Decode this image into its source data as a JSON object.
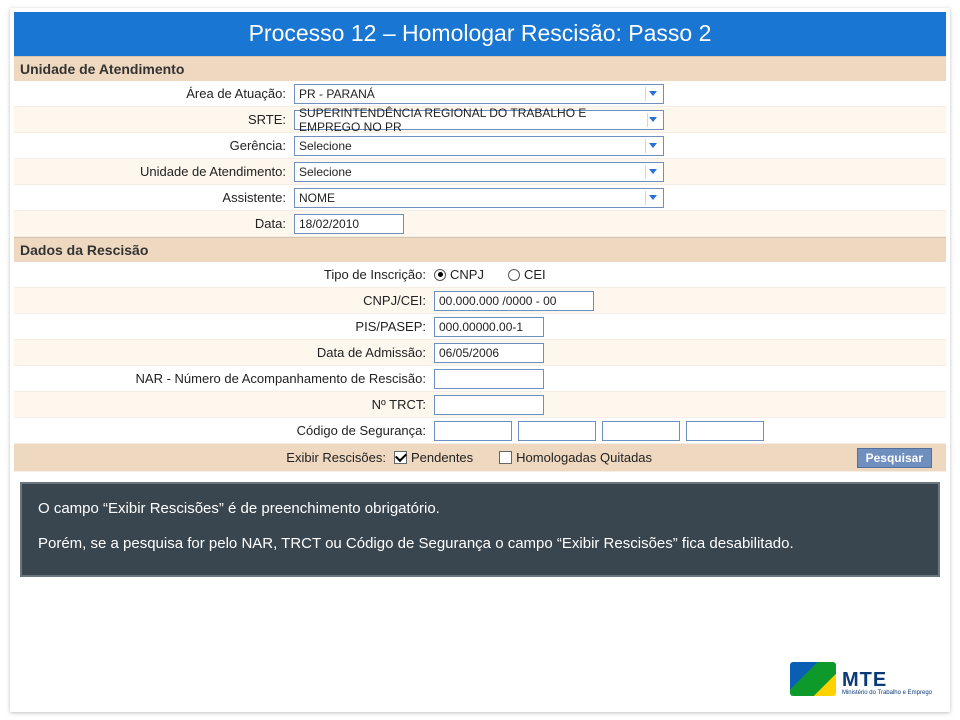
{
  "title": "Processo 12 – Homologar Rescisão: Passo 2",
  "sections": {
    "unidade_header": "Unidade de Atendimento",
    "dados_header": "Dados da Rescisão"
  },
  "unidade": {
    "area_label": "Área de Atuação:",
    "area_value": "PR - PARANÁ",
    "srte_label": "SRTE:",
    "srte_value": "SUPERINTENDÊNCIA REGIONAL DO TRABALHO E EMPREGO NO PR",
    "gerencia_label": "Gerência:",
    "gerencia_value": "Selecione",
    "unidade_label": "Unidade de Atendimento:",
    "unidade_value": "Selecione",
    "assistente_label": "Assistente:",
    "assistente_value": "NOME",
    "data_label": "Data:",
    "data_value": "18/02/2010"
  },
  "rescisao": {
    "tipo_label": "Tipo de Inscrição:",
    "tipo_cnpj": "CNPJ",
    "tipo_cei": "CEI",
    "cnpj_label": "CNPJ/CEI:",
    "cnpj_value": "00.000.000 /0000 - 00",
    "pis_label": "PIS/PASEP:",
    "pis_value": "000.00000.00-1",
    "adm_label": "Data de Admissão:",
    "adm_value": "06/05/2006",
    "nar_label": "NAR - Número de Acompanhamento de Rescisão:",
    "trct_label": "Nº TRCT:",
    "cod_label": "Código de Segurança:",
    "exibir_label": "Exibir Rescisões:",
    "pendentes": "Pendentes",
    "homolog": "Homologadas Quitadas"
  },
  "buttons": {
    "pesquisar": "Pesquisar"
  },
  "note": {
    "line1": "O campo “Exibir Rescisões” é de preenchimento obrigatório.",
    "line2": "Porém, se a pesquisa for pelo NAR,  TRCT ou Código de Segurança o campo “Exibir Rescisões” fica desabilitado."
  },
  "logo": {
    "abbr": "MTE",
    "full": "Ministério do Trabalho e Emprego"
  }
}
